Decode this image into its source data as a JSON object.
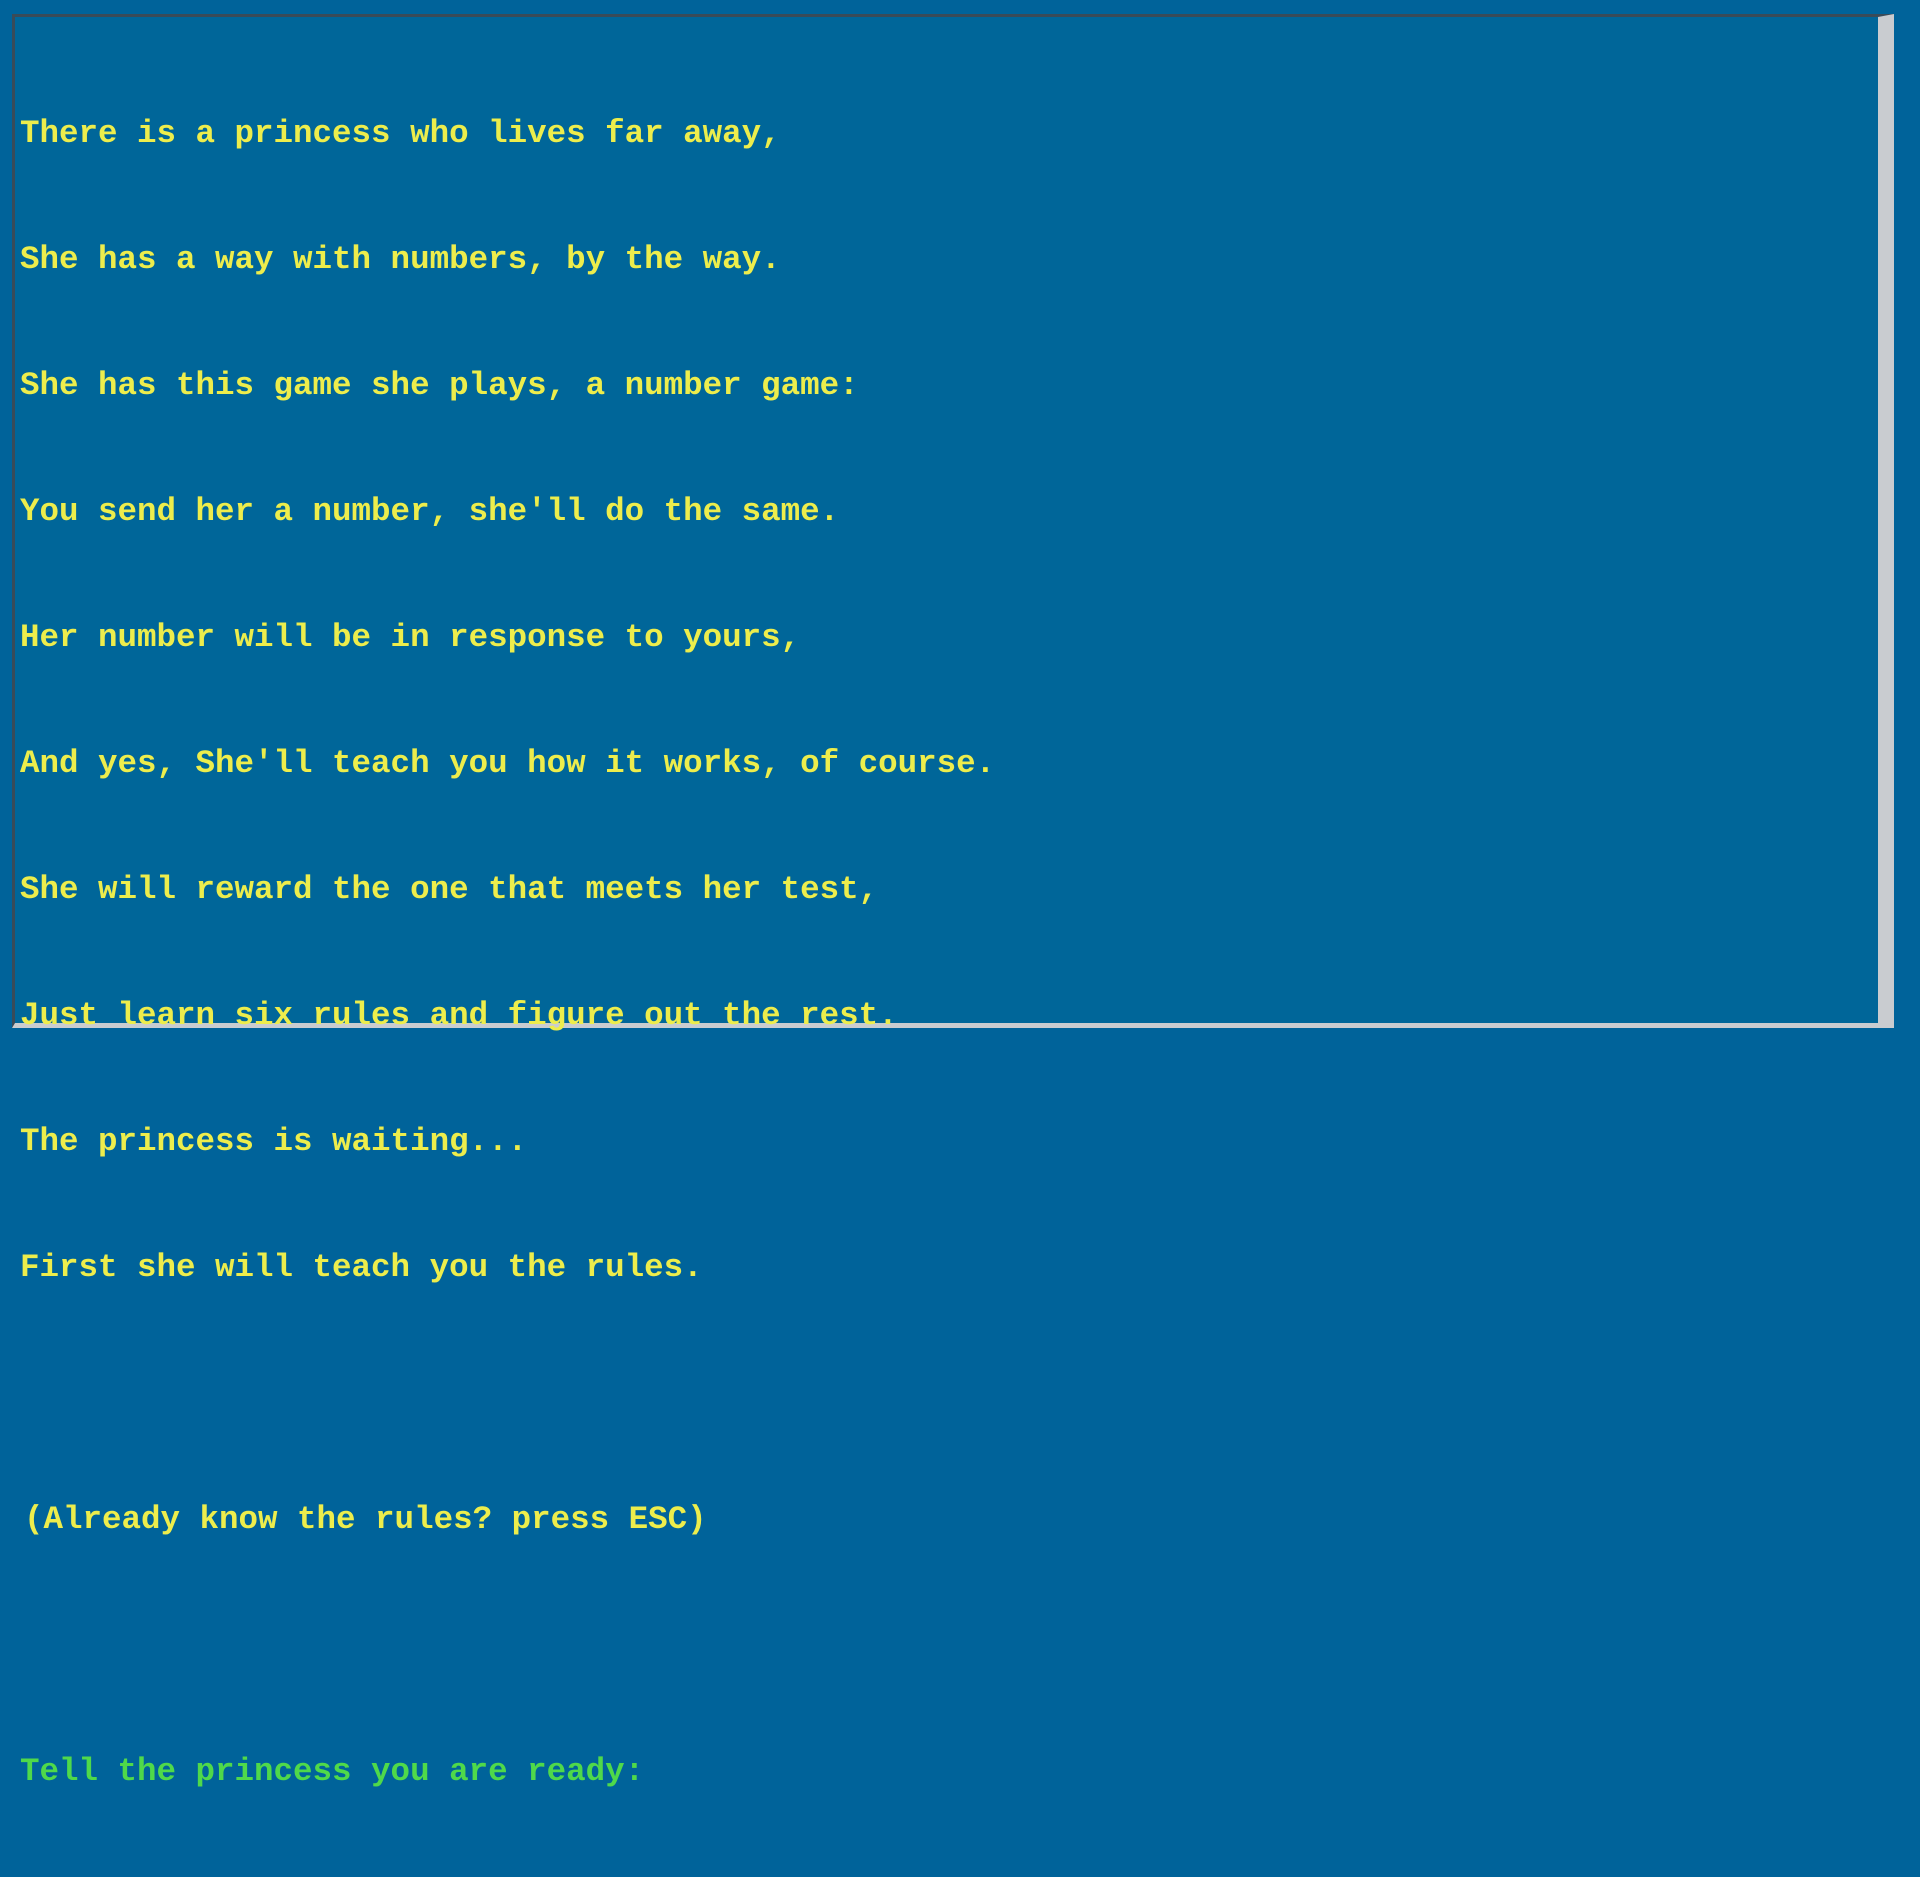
{
  "intro": {
    "lines": [
      "There is a princess who lives far away,",
      "She has a way with numbers, by the way.",
      "She has this game she plays, a number game:",
      "You send her a number, she'll do the same.",
      "Her number will be in response to yours,",
      "And yes, She'll teach you how it works, of course.",
      "She will reward the one that meets her test,",
      "Just learn six rules and figure out the rest.",
      "The princess is waiting...",
      "First she will teach you the rules."
    ],
    "esc_hint": "(Already know the rules? press ESC)",
    "prompt": "Tell the princess you are ready:",
    "input_value": ""
  },
  "colors": {
    "background": "#006699",
    "text": "#eded4c",
    "prompt": "#4fd94a",
    "frame_light": "#c9ccd0",
    "frame_dark": "#3a4b58"
  }
}
